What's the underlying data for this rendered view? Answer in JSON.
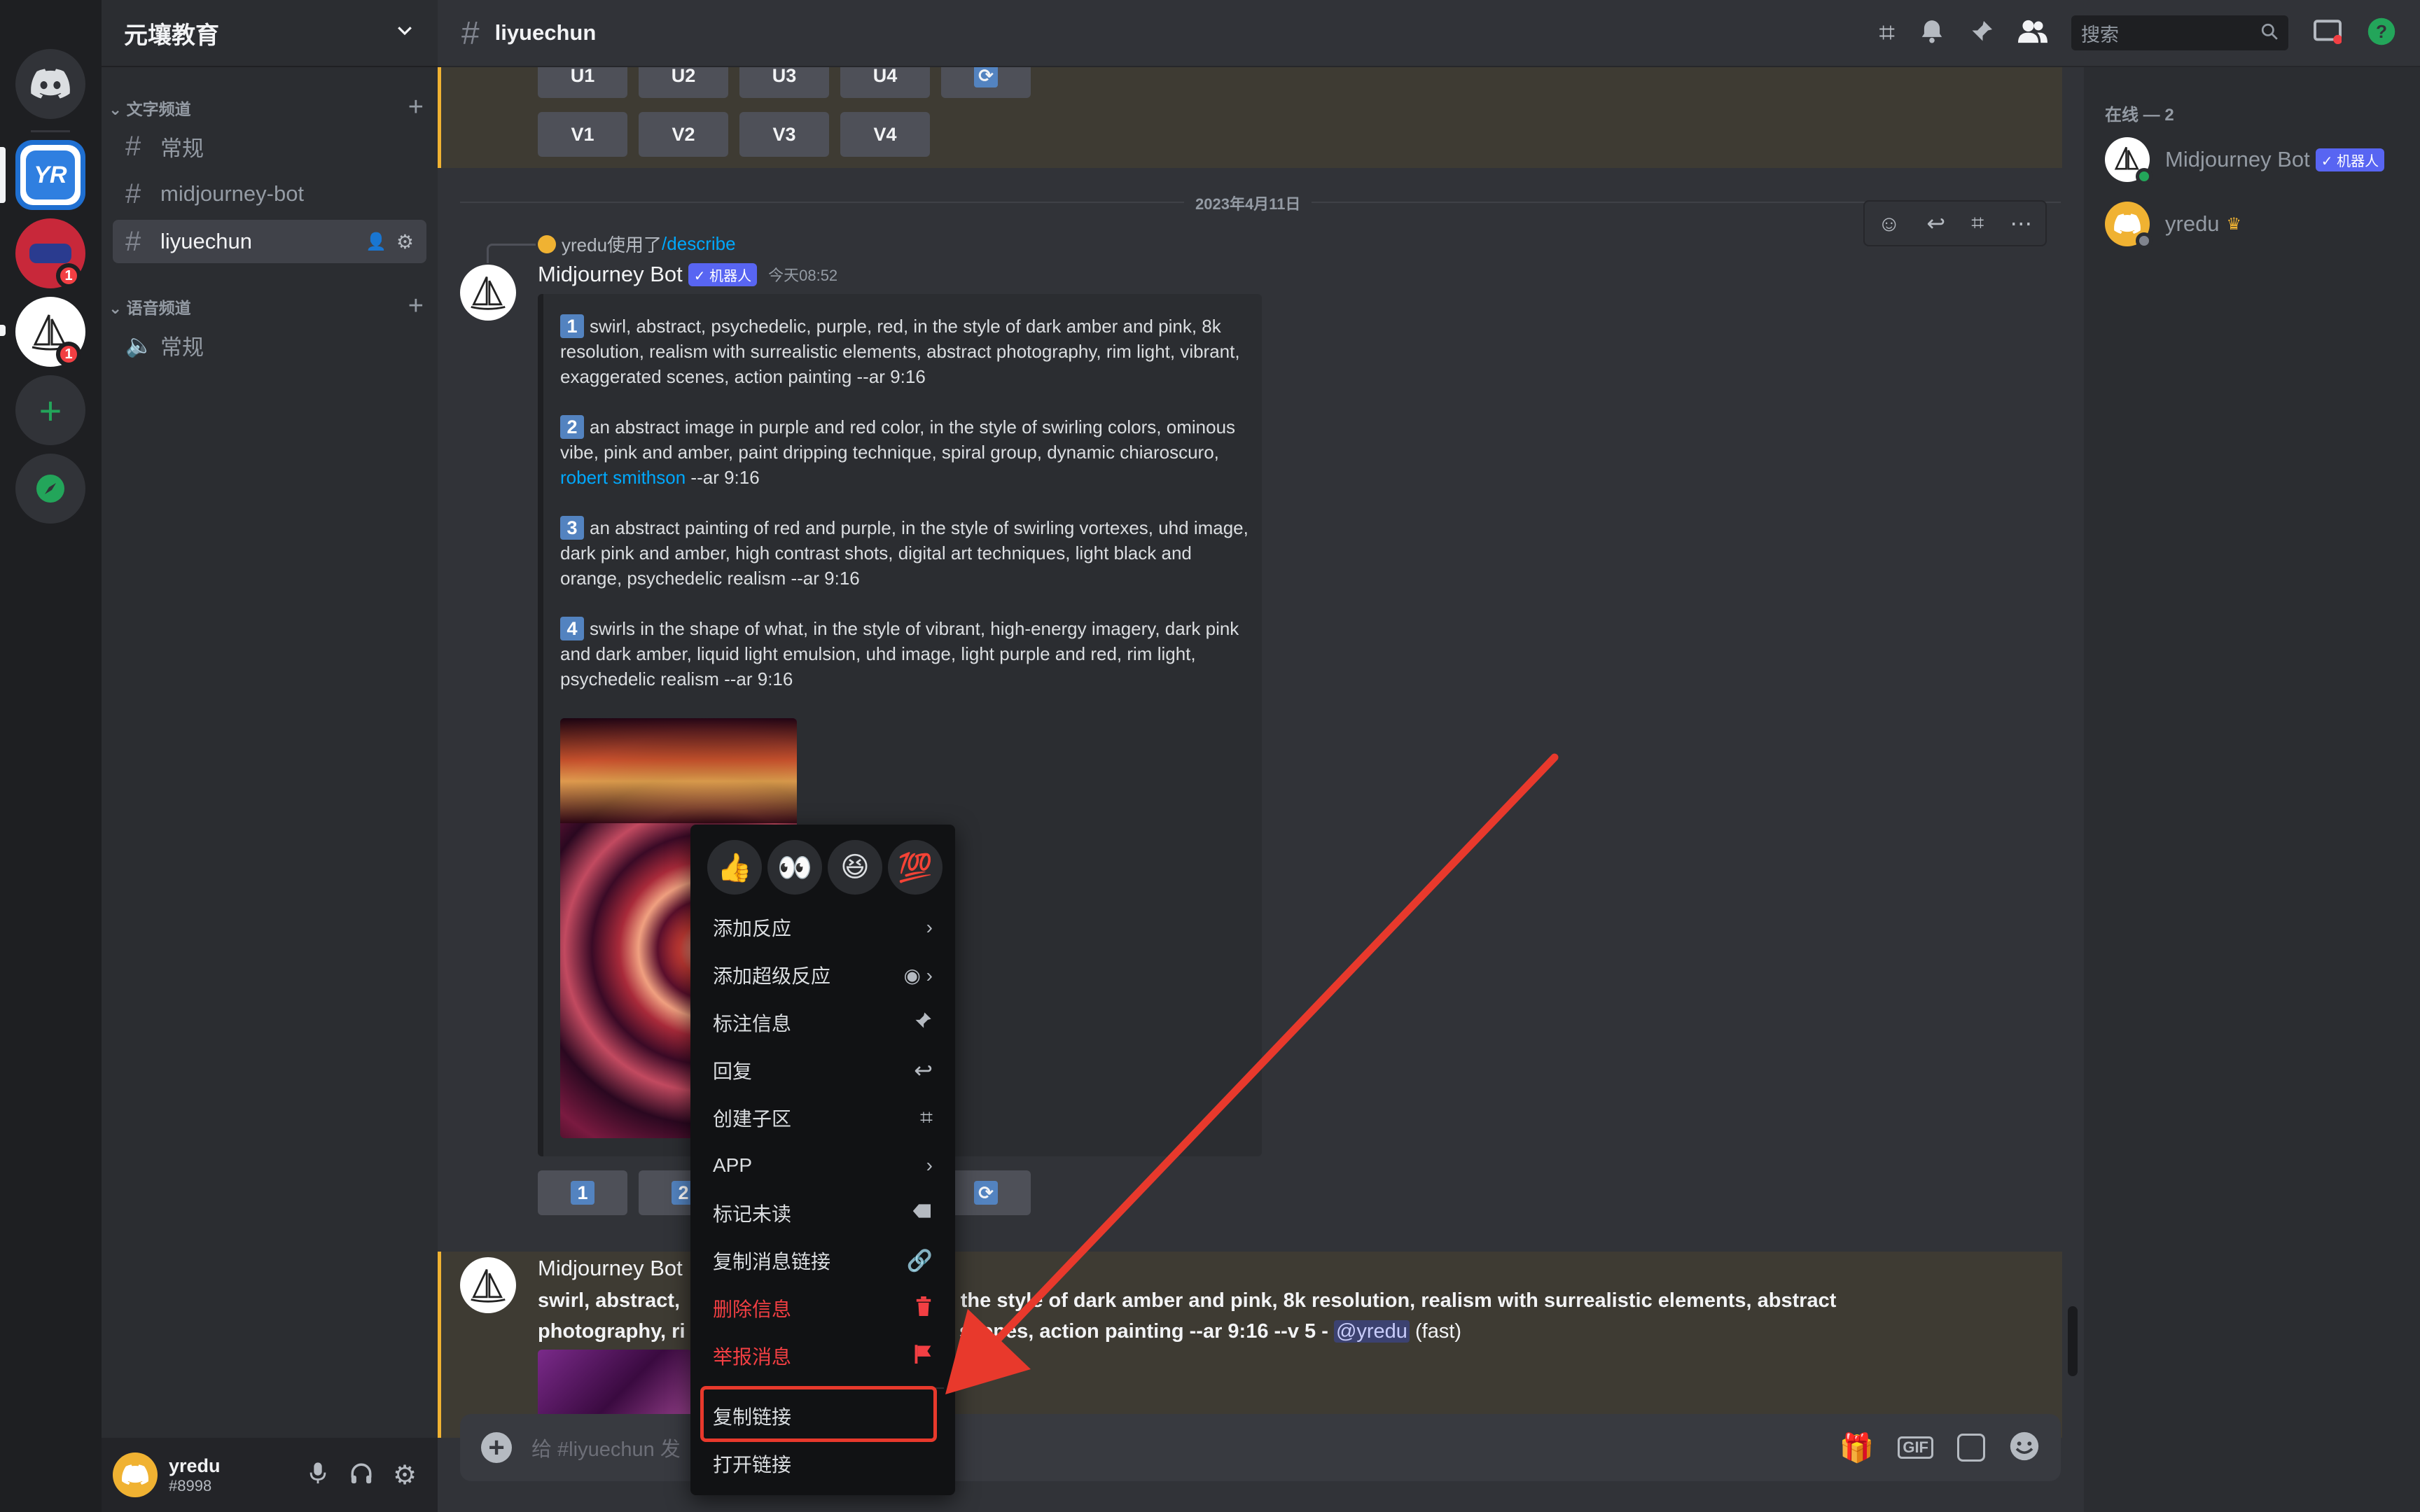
{
  "server_rail": {
    "badges": [
      "1",
      "1"
    ]
  },
  "guild": {
    "name": "元壤教育",
    "text_category": "文字频道",
    "voice_category": "语音频道",
    "text_channels": [
      "常规",
      "midjourney-bot",
      "liyuechun"
    ],
    "voice_channels": [
      "常规"
    ]
  },
  "user": {
    "name": "yredu",
    "tag": "#8998"
  },
  "header": {
    "channel": "liyuechun",
    "search_placeholder": "搜索"
  },
  "members": {
    "section": "在线 — 2",
    "list": [
      {
        "name": "Midjourney Bot",
        "badge": "✓ 机器人"
      },
      {
        "name": "yredu",
        "badge": ""
      }
    ]
  },
  "chat": {
    "upscale_buttons": [
      "U1",
      "U2",
      "U3",
      "U4"
    ],
    "variation_buttons": [
      "V1",
      "V2",
      "V3",
      "V4"
    ],
    "date_divider": "2023年4月11日",
    "reply_user": "yredu使用了",
    "reply_command": "/describe",
    "author": "Midjourney Bot",
    "bot_badge": "✓ 机器人",
    "timestamp": "今天08:52",
    "prompts": [
      {
        "num": "1",
        "text": "swirl, abstract, psychedelic, purple, red, in the style of dark amber and pink, 8k resolution, realism with surrealistic elements, abstract photography, rim light, vibrant, exaggerated scenes, action painting --ar 9:16"
      },
      {
        "num": "2",
        "text_before": "an abstract image in purple and red color, in the style of swirling colors, ominous vibe, pink and amber, paint dripping technique, spiral group, dynamic chiaroscuro, ",
        "link": "robert smithson",
        "text_after": " --ar 9:16"
      },
      {
        "num": "3",
        "text": "an abstract painting of red and purple, in the style of swirling vortexes, uhd image, dark pink and amber, high contrast shots, digital art techniques, light black and orange, psychedelic realism --ar 9:16"
      },
      {
        "num": "4",
        "text": "swirls in the shape of what, in the style of vibrant, high-energy imagery, dark pink and dark amber, liquid light emulsion, uhd image, light purple and red, rim light, psychedelic realism --ar 9:16"
      }
    ],
    "num_buttons": [
      "1",
      "2"
    ],
    "second_author": "Midjourney Bot",
    "second_line1": "swirl, abstract,",
    "second_line1_tail": "n the style of dark amber and pink, 8k resolution, realism with surrealistic elements, abstract",
    "second_line2": "photography, ri",
    "second_line2_tail": "ed scenes, action painting --ar 9:16 --v 5 -",
    "mention": "@yredu",
    "speed": "(fast)"
  },
  "context_menu": {
    "emojis": [
      "👍",
      "👀",
      "😆",
      "💯"
    ],
    "items": [
      {
        "label": "添加反应",
        "icon": "chevron-right-icon",
        "danger": false
      },
      {
        "label": "添加超级反应",
        "icon": "super-reaction-icon",
        "danger": false
      },
      {
        "label": "标注信息",
        "icon": "pin-icon",
        "danger": false
      },
      {
        "label": "回复",
        "icon": "reply-icon",
        "danger": false
      },
      {
        "label": "创建子区",
        "icon": "thread-icon",
        "danger": false
      },
      {
        "label": "APP",
        "icon": "chevron-right-icon",
        "danger": false
      },
      {
        "label": "标记未读",
        "icon": "mark-unread-icon",
        "danger": false
      },
      {
        "label": "复制消息链接",
        "icon": "link-icon",
        "danger": false
      },
      {
        "label": "删除信息",
        "icon": "trash-icon",
        "danger": true
      },
      {
        "label": "举报消息",
        "icon": "flag-icon",
        "danger": true
      },
      {
        "label": "复制链接",
        "icon": "",
        "danger": false
      },
      {
        "label": "打开链接",
        "icon": "",
        "danger": false
      }
    ]
  },
  "composer": {
    "placeholder": "给 #liyuechun 发"
  },
  "colors": {
    "accent": "#5865f2",
    "danger": "#f23f43",
    "highlight_box": "#e8392c",
    "arrow": "#e8392c",
    "online": "#23a55a"
  }
}
